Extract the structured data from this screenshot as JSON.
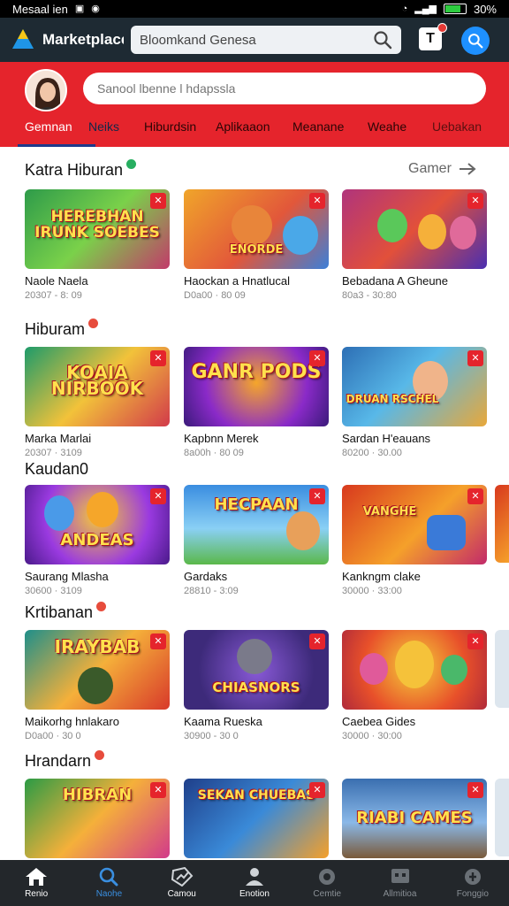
{
  "status_bar": {
    "carrier": "Mesaal ien",
    "battery": "30%"
  },
  "header": {
    "app_title": "Marketplace",
    "search_value": "Bloomkand Genesa",
    "notification_label": "T",
    "logo_icon": "triangle-logo-icon"
  },
  "profile_bar": {
    "search_placeholder": "Sanool lbenne l hdapssla"
  },
  "tabs": [
    {
      "label": "Gemnan",
      "active": true
    },
    {
      "label": "Neiks"
    },
    {
      "label": "Hiburdsin"
    },
    {
      "label": "Aplikaaon"
    },
    {
      "label": "Meanane"
    },
    {
      "label": "Weahe"
    },
    {
      "label": "Uebakan"
    }
  ],
  "sections": [
    {
      "title": "Katra Hiburan",
      "see_all": "Gamer",
      "dot_color": "#27ae60",
      "cards": [
        {
          "title": "Naole Naela",
          "meta": "20307 - 8: 09",
          "art": "HEREBHAN IRUNK SOEBES",
          "bg": "#2e9b4a"
        },
        {
          "title": "Haockan a Hnatlucal",
          "meta": "D0a00 · 80 09",
          "art": "ENORDE",
          "bg": "#e08a1e"
        },
        {
          "title": "Bebadana A Gheune",
          "meta": "80a3 - 30:80",
          "art": "",
          "bg": "#b0347c"
        }
      ]
    },
    {
      "title": "Hiburam",
      "dot_color": "#e74c3c",
      "cards": [
        {
          "title": "Marka Marlai",
          "meta": "20307 · 3109",
          "art": "KOAIA NIRBOOK",
          "bg": "#1e9b6a"
        },
        {
          "title": "Kapbnn Merek",
          "meta": "8a00h · 80 09",
          "art": "GANR PODS",
          "bg": "#6a2aa8"
        },
        {
          "title": "Sardan H'eauans",
          "meta": "80200 · 30.00",
          "art": "DRUAN RSCHEL",
          "bg": "#2d6fb5"
        }
      ]
    },
    {
      "title": "Kaudan0",
      "cards": [
        {
          "title": "Saurang Mlasha",
          "meta": "30600 · 3109",
          "art": "ANDEAS",
          "bg": "#7b2fc1"
        },
        {
          "title": "Gardaks",
          "meta": "28810 - 3:09",
          "art": "HECPAAN",
          "bg": "#3a8de0"
        },
        {
          "title": "Kankngm clake",
          "meta": "30000 · 33:00",
          "art": "VANGHE",
          "bg": "#d8391e"
        }
      ]
    },
    {
      "title": "Krtibanan",
      "dot_color": "#e74c3c",
      "cards": [
        {
          "title": "Maikorhg hnlakaro",
          "meta": "D0a00 · 30 0",
          "art": "IRAYBAB",
          "bg": "#1f8f8a"
        },
        {
          "title": "Kaama Rueska",
          "meta": "30900 - 30 0",
          "art": "CHIASNORS",
          "bg": "#3d2a7a"
        },
        {
          "title": "Caebea Gides",
          "meta": "30000 · 30:00",
          "art": "",
          "bg": "#e8502a"
        }
      ]
    },
    {
      "title": "Hrandarn",
      "dot_color": "#e74c3c",
      "cards": [
        {
          "title": "",
          "meta": "",
          "art": "HIBRAN",
          "bg": "#2b9b45"
        },
        {
          "title": "",
          "meta": "",
          "art": "SEKAN CHUEBAS",
          "bg": "#1f3f8a"
        },
        {
          "title": "",
          "meta": "",
          "art": "RIABI CAMES",
          "bg": "#3a6fb0"
        }
      ]
    }
  ],
  "bottom_nav": [
    {
      "label": "Renio",
      "icon": "home-icon",
      "active": true
    },
    {
      "label": "Naohe",
      "icon": "search-icon"
    },
    {
      "label": "Camou",
      "icon": "tag-icon"
    },
    {
      "label": "Enotion",
      "icon": "person-icon"
    },
    {
      "label": "Cemtie",
      "icon": "globe-icon",
      "dim": true
    },
    {
      "label": "Allmitioa",
      "icon": "chat-icon",
      "dim": true
    },
    {
      "label": "Fonggio",
      "icon": "settings-icon",
      "dim": true
    }
  ]
}
